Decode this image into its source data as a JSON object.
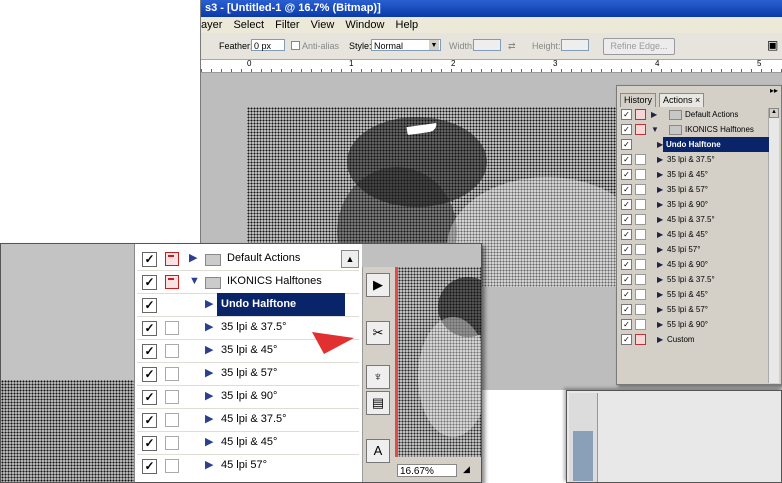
{
  "window": {
    "title": "s3 - [Untitled-1 @ 16.7% (Bitmap)]",
    "menu": [
      "ayer",
      "Select",
      "Filter",
      "View",
      "Window",
      "Help"
    ]
  },
  "options": {
    "feather_label": "Feather:",
    "feather_value": "0 px",
    "antialias_label": "Anti-alias",
    "style_label": "Style:",
    "style_value": "Normal",
    "width_label": "Width:",
    "height_label": "Height:",
    "refine_label": "Refine Edge..."
  },
  "ruler": [
    "0",
    "1",
    "2",
    "3",
    "4",
    "5"
  ],
  "actions_panel": {
    "tabs": [
      "History",
      "Actions ×"
    ],
    "rows": [
      {
        "label": "Default Actions",
        "folder": true
      },
      {
        "label": "IKONICS Halftones",
        "folder": true,
        "expanded": true
      },
      {
        "label": "Undo Halftone",
        "selected": true
      },
      {
        "label": "35 lpi & 37.5°"
      },
      {
        "label": "35 lpi & 45°"
      },
      {
        "label": "35 lpi & 57°"
      },
      {
        "label": "35 lpi & 90°"
      },
      {
        "label": "45 lpi & 37.5°"
      },
      {
        "label": "45 lpi & 45°"
      },
      {
        "label": "45 lpi  57°"
      },
      {
        "label": "45 lpi & 90°"
      },
      {
        "label": "55 lpi & 37.5°"
      },
      {
        "label": "55 lpi & 45°"
      },
      {
        "label": "55 lpi & 57°"
      },
      {
        "label": "55 lpi & 90°"
      },
      {
        "label": "Custom"
      }
    ]
  },
  "zoom_panel": {
    "rows": [
      {
        "label": "Default Actions",
        "folder": true
      },
      {
        "label": "IKONICS Halftones",
        "folder": true,
        "expanded": true
      },
      {
        "label": "Undo Halftone",
        "selected": true
      },
      {
        "label": "35 lpi & 37.5°"
      },
      {
        "label": "35 lpi & 45°"
      },
      {
        "label": "35 lpi & 57°"
      },
      {
        "label": "35 lpi & 90°"
      },
      {
        "label": "45 lpi & 37.5°"
      },
      {
        "label": "45 lpi & 45°"
      },
      {
        "label": "45 lpi  57°"
      }
    ],
    "zoom_level": "16.67%"
  },
  "colors": {
    "accent": "#0a246a",
    "arrow": "#e03030",
    "title_bar": "#0a3aa8"
  },
  "icons": [
    "play-icon",
    "tools-icon",
    "brush-icon",
    "paste-icon",
    "text-icon",
    "triangle-right-icon",
    "folder-icon",
    "checkbox-icon"
  ]
}
